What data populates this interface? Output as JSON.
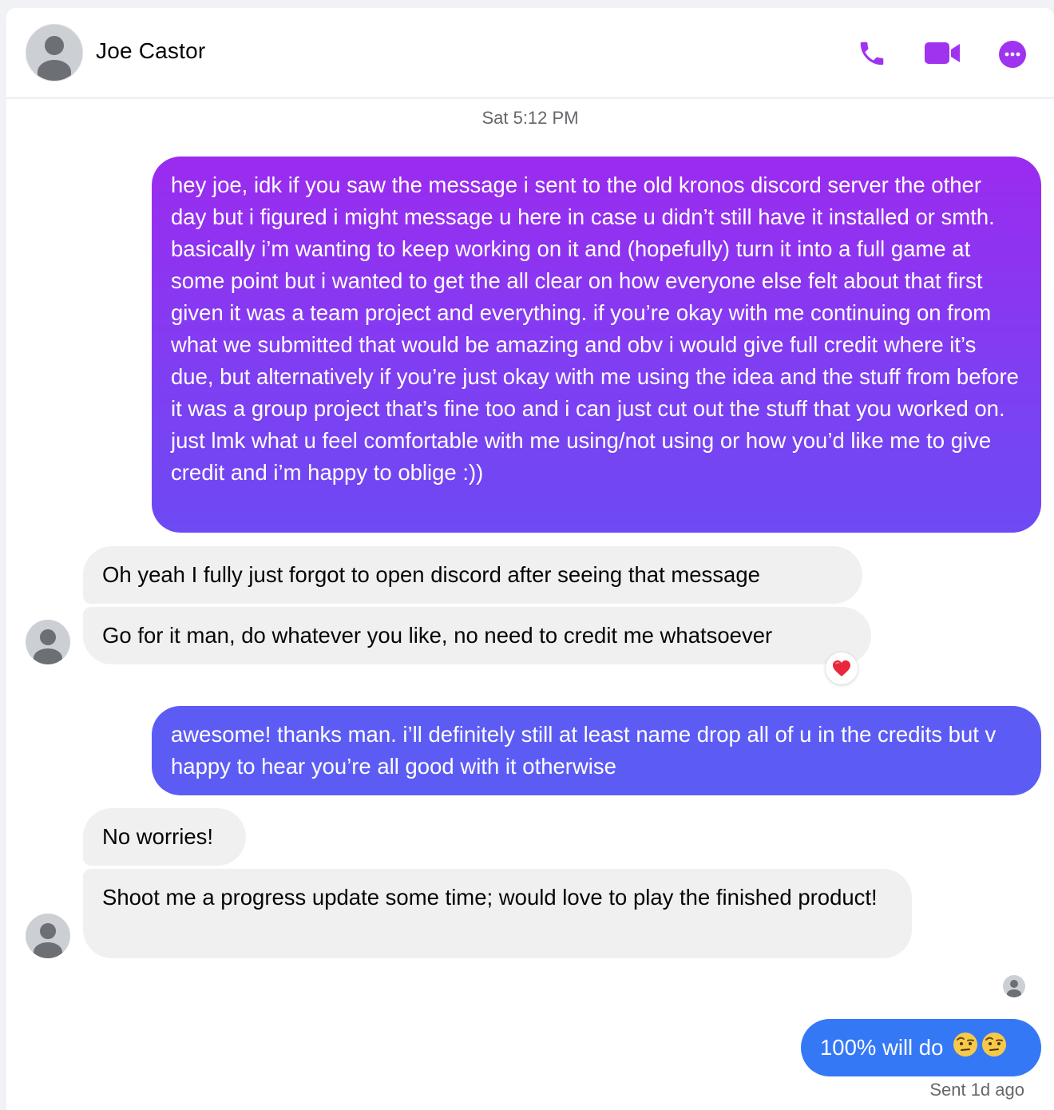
{
  "header": {
    "contact_name": "Joe Castor",
    "icons": [
      "avatar",
      "phone-icon",
      "video-camera-icon",
      "more-options-icon"
    ],
    "accent_color": "#a033f0"
  },
  "timestamp": "Sat 5:12 PM",
  "messages": [
    {
      "sender": "me",
      "text": "hey joe, idk if you saw the message i sent to the old kronos discord server the other day but i figured i might message u here in case u didn’t still have it installed or smth. basically i’m wanting to keep working on it and (hopefully) turn it into a full game at some point but i wanted to get the all clear on how everyone else felt about that first given it was a team project and everything. if you’re okay with me continuing on from what we submitted that would be amazing and obv i would give full credit where it’s due, but alternatively if you’re just okay with me using the idea and the stuff from before it was a group project that’s fine too and i can just cut out the stuff that you worked on. just lmk what u feel comfortable with me using/not using or how you’d like me to give credit and i’m happy to oblige :))"
    },
    {
      "sender": "Joe Castor",
      "text": "Oh yeah I fully just forgot to open discord after seeing that message"
    },
    {
      "sender": "Joe Castor",
      "text": "Go for it man, do whatever you like, no need to credit me whatsoever",
      "reaction": "heart"
    },
    {
      "sender": "me",
      "text": "awesome! thanks man. i’ll definitely still at least name drop all of u in the credits but v happy to hear you’re all good with it otherwise"
    },
    {
      "sender": "Joe Castor",
      "text": "No worries!"
    },
    {
      "sender": "Joe Castor",
      "text": "Shoot me a progress update some time; would love to play the finished product!"
    },
    {
      "sender": "me",
      "text": "100% will do",
      "emojis": [
        "face-with-raised-eyebrow",
        "face-with-raised-eyebrow"
      ]
    }
  ],
  "sent_status": "Sent 1d ago",
  "colors": {
    "outgoing_gradient_top": "#9b2bf0",
    "outgoing_mid": "#5c5cf5",
    "outgoing_bottom": "#3478f6",
    "incoming_bg": "#f0f0f0"
  }
}
